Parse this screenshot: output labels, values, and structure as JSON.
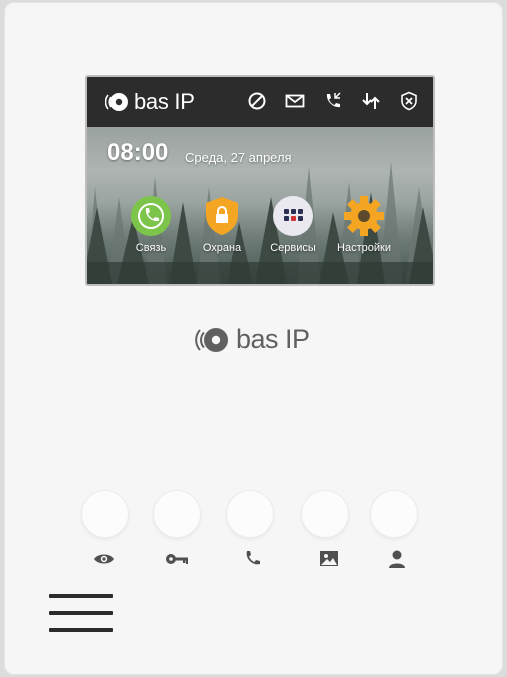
{
  "screen": {
    "brand_text": "bas IP",
    "time": "08:00",
    "date": "Среда, 27 апреля",
    "status_icons": [
      "no-disturb-icon",
      "envelope-icon",
      "call-log-icon",
      "sync-icon",
      "shield-disarm-icon"
    ],
    "apps": [
      {
        "label": "Связь",
        "icon": "phone-icon",
        "color": "#7cc44a"
      },
      {
        "label": "Охрана",
        "icon": "security-lock-icon",
        "color": "#f4a623"
      },
      {
        "label": "Сервисы",
        "icon": "grid-icon",
        "color": "#e9e9ef"
      },
      {
        "label": "Настройки",
        "icon": "gear-icon",
        "color": "#f4a623"
      }
    ]
  },
  "device": {
    "brand_text": "bas IP",
    "buttons": [
      "eye-icon",
      "key-icon",
      "phone-icon",
      "image-icon",
      "person-icon"
    ]
  }
}
